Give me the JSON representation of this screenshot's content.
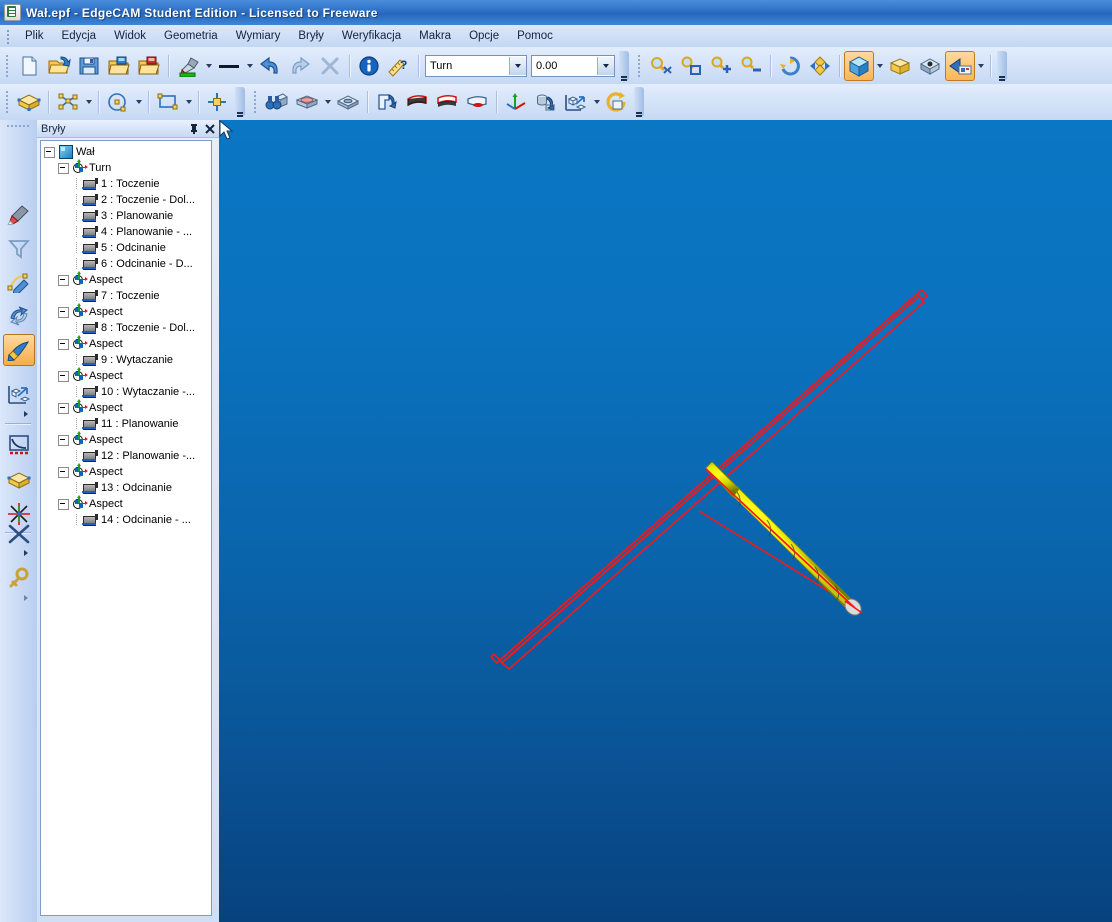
{
  "window": {
    "title": "Wał.epf - EdgeCAM Student Edition - Licensed to Freeware",
    "app_icon": "document-epf-icon"
  },
  "menubar": {
    "items": [
      {
        "label": "Plik",
        "mnemonic": "P"
      },
      {
        "label": "Edycja",
        "mnemonic": "E"
      },
      {
        "label": "Widok",
        "mnemonic": "W"
      },
      {
        "label": "Geometria",
        "mnemonic": "G"
      },
      {
        "label": "Wymiary",
        "mnemonic": "W"
      },
      {
        "label": "Bryły",
        "mnemonic": "B"
      },
      {
        "label": "Weryfikacja",
        "mnemonic": "W"
      },
      {
        "label": "Makra",
        "mnemonic": "M"
      },
      {
        "label": "Opcje",
        "mnemonic": ""
      },
      {
        "label": "Pomoc",
        "mnemonic": "P"
      }
    ]
  },
  "toolbar_main": {
    "buttons": [
      {
        "name": "new-file-icon",
        "title": "Nowy"
      },
      {
        "name": "open-file-icon",
        "title": "Otwórz"
      },
      {
        "name": "save-file-icon",
        "title": "Zapisz"
      },
      {
        "name": "open-folder-blue-icon",
        "title": "Otwórz folder"
      },
      {
        "name": "open-folder-red-icon",
        "title": "Otwórz folder"
      },
      {
        "name": "color-picker-icon",
        "title": "Kolor"
      },
      {
        "name": "line-style-icon",
        "title": "Styl linii"
      },
      {
        "name": "undo-icon",
        "title": "Cofnij"
      },
      {
        "name": "redo-icon",
        "title": "Ponów"
      },
      {
        "name": "delete-x-icon",
        "title": "Usuń"
      },
      {
        "name": "info-icon",
        "title": "Informacje"
      },
      {
        "name": "measure-help-icon",
        "title": "Pomiar"
      }
    ],
    "combo_mode": {
      "value": "Turn",
      "name": "machining-mode-combo"
    },
    "combo_level": {
      "value": "0.00",
      "name": "level-combo"
    },
    "view_buttons": [
      {
        "name": "zoom-fit-icon",
        "title": "Dopasuj"
      },
      {
        "name": "zoom-window-icon",
        "title": "Powiększ okno"
      },
      {
        "name": "zoom-in-icon",
        "title": "Powiększ"
      },
      {
        "name": "zoom-out-icon",
        "title": "Pomniejsz"
      },
      {
        "name": "rotate-view-icon",
        "title": "Obróć"
      },
      {
        "name": "pan-view-icon",
        "title": "Przesuń"
      },
      {
        "name": "isometric-view-icon",
        "title": "Widok izometryczny",
        "active": true
      },
      {
        "name": "shaded-box-icon",
        "title": "Cieniowanie"
      },
      {
        "name": "render-icon",
        "title": "Render"
      },
      {
        "name": "view-preset-icon",
        "title": "Widoki",
        "active": true
      }
    ]
  },
  "toolbar_second": {
    "buttons": [
      {
        "name": "solid-box-icon",
        "title": "Bryła"
      },
      {
        "name": "polyline-nodes-icon",
        "title": "Linia łamana"
      },
      {
        "name": "circle-icon",
        "title": "Okrąg"
      },
      {
        "name": "rectangle-icon",
        "title": "Prostokąt"
      },
      {
        "name": "snap-cross-icon",
        "title": "Punkt przyciągania"
      },
      {
        "name": "binoculars-icon",
        "title": "Szukaj"
      },
      {
        "name": "plate-icon",
        "title": "Płyta"
      },
      {
        "name": "pocket-icon",
        "title": "Kieszeń"
      },
      {
        "name": "extrude-icon",
        "title": "Wyciągnięcie"
      },
      {
        "name": "loft-red-icon",
        "title": "Powierzchnia"
      },
      {
        "name": "sweep-red-icon",
        "title": "Przeciągnięcie"
      },
      {
        "name": "revolve-red-icon",
        "title": "Obrót"
      },
      {
        "name": "axes-icon",
        "title": "Układ współrzędnych"
      },
      {
        "name": "cylinder-rotate-icon",
        "title": "Obróć bryłę"
      },
      {
        "name": "transform-copy-icon",
        "title": "Transformacja"
      },
      {
        "name": "regenerate-icon",
        "title": "Regeneruj"
      }
    ]
  },
  "toolbar_left": {
    "buttons": [
      {
        "name": "eraser-icon",
        "title": "Gumka"
      },
      {
        "name": "filter-funnel-icon",
        "title": "Filtr"
      },
      {
        "name": "edit-curve-icon",
        "title": "Edytuj krzywą"
      },
      {
        "name": "rotate-arrows-icon",
        "title": "Obróć"
      },
      {
        "name": "sweep-paint-icon",
        "title": "Przeciągnij",
        "active": true
      },
      {
        "name": "transform-box-icon",
        "title": "Transformuj",
        "submenu": true
      },
      {
        "name": "profile-curve-icon",
        "title": "Profil"
      },
      {
        "name": "solid-open-box-icon",
        "title": "Bryła otwarta"
      },
      {
        "name": "explode-star-icon",
        "title": "Rozbij"
      },
      {
        "name": "cross-delete-icon",
        "title": "Usuń",
        "submenu": true
      },
      {
        "name": "key-unlock-icon",
        "title": "Odblokuj",
        "submenu": true
      }
    ]
  },
  "panel": {
    "title": "Bryły",
    "pin_icon": "pin-icon",
    "close_icon": "close-icon",
    "tree": [
      {
        "level": 0,
        "label": "Wał",
        "icon": "root-solid-icon",
        "expander": true
      },
      {
        "level": 1,
        "label": "Turn",
        "icon": "aspect-icon",
        "expander": true
      },
      {
        "level": 2,
        "label": "1 : Toczenie",
        "icon": "operation-icon",
        "expander": false
      },
      {
        "level": 2,
        "label": "2 : Toczenie - Dol...",
        "icon": "operation-icon",
        "expander": false
      },
      {
        "level": 2,
        "label": "3 : Planowanie",
        "icon": "operation-icon",
        "expander": false
      },
      {
        "level": 2,
        "label": "4 : Planowanie - ...",
        "icon": "operation-icon",
        "expander": false
      },
      {
        "level": 2,
        "label": "5 : Odcinanie",
        "icon": "operation-icon",
        "expander": false
      },
      {
        "level": 2,
        "label": "6 : Odcinanie - D...",
        "icon": "operation-icon",
        "expander": false
      },
      {
        "level": 1,
        "label": "Aspect",
        "icon": "aspect-icon",
        "expander": true
      },
      {
        "level": 2,
        "label": "7 : Toczenie",
        "icon": "operation-icon",
        "expander": false
      },
      {
        "level": 1,
        "label": "Aspect",
        "icon": "aspect-icon",
        "expander": true
      },
      {
        "level": 2,
        "label": "8 : Toczenie - Dol...",
        "icon": "operation-icon",
        "expander": false
      },
      {
        "level": 1,
        "label": "Aspect",
        "icon": "aspect-icon",
        "expander": true
      },
      {
        "level": 2,
        "label": "9 : Wytaczanie",
        "icon": "operation-icon",
        "expander": false
      },
      {
        "level": 1,
        "label": "Aspect",
        "icon": "aspect-icon",
        "expander": true
      },
      {
        "level": 2,
        "label": "10 : Wytaczanie -...",
        "icon": "operation-icon",
        "expander": false
      },
      {
        "level": 1,
        "label": "Aspect",
        "icon": "aspect-icon",
        "expander": true
      },
      {
        "level": 2,
        "label": "11 : Planowanie",
        "icon": "operation-icon",
        "expander": false
      },
      {
        "level": 1,
        "label": "Aspect",
        "icon": "aspect-icon",
        "expander": true
      },
      {
        "level": 2,
        "label": "12 : Planowanie -...",
        "icon": "operation-icon",
        "expander": false
      },
      {
        "level": 1,
        "label": "Aspect",
        "icon": "aspect-icon",
        "expander": true
      },
      {
        "level": 2,
        "label": "13 : Odcinanie",
        "icon": "operation-icon",
        "expander": false
      },
      {
        "level": 1,
        "label": "Aspect",
        "icon": "aspect-icon",
        "expander": true
      },
      {
        "level": 2,
        "label": "14 : Odcinanie - ...",
        "icon": "operation-icon",
        "expander": false
      }
    ]
  },
  "viewport": {
    "name": "3d-viewport",
    "background_top": "#0a77c4",
    "background_bottom": "#07427f",
    "model": {
      "name": "turned-shaft-model",
      "body_color": "#e8e800",
      "body_shade_dark": "#8a8a00",
      "end_face_color": "#d8d8d8"
    },
    "toolpath": {
      "name": "toolpath-outline",
      "color": "#ff1414",
      "start": "lower-left",
      "end": "upper-right"
    },
    "cursor_icon": "mouse-pointer-icon"
  }
}
